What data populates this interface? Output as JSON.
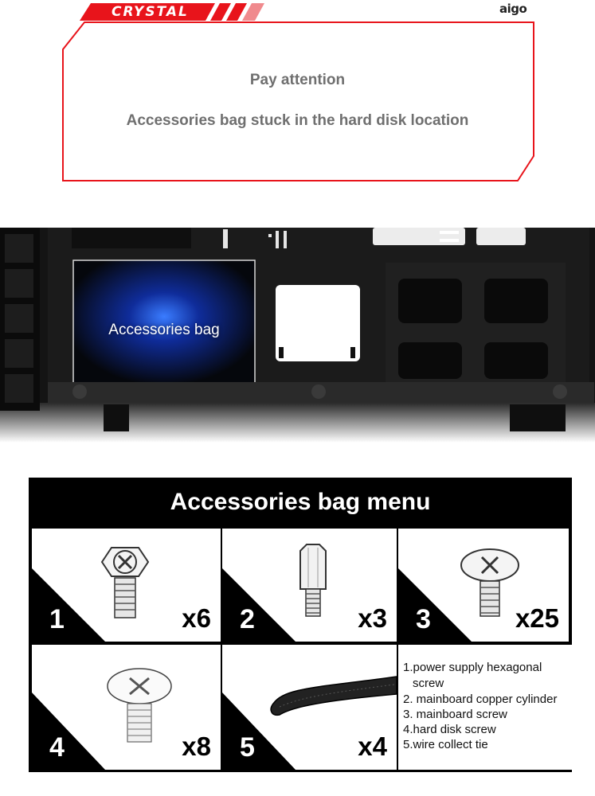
{
  "header": {
    "brand_tag": "CRYSTAL",
    "logo": "aigo",
    "accent_color": "#e8141b"
  },
  "notice": {
    "title": "Pay attention",
    "message": "Accessories bag stuck in the hard disk location"
  },
  "photo": {
    "bag_label": "Accessories bag"
  },
  "menu": {
    "title": "Accessories bag menu",
    "items": [
      {
        "number": "1",
        "quantity": "x6",
        "icon": "hex-screw-icon"
      },
      {
        "number": "2",
        "quantity": "x3",
        "icon": "copper-cylinder-icon"
      },
      {
        "number": "3",
        "quantity": "x25",
        "icon": "mainboard-screw-icon"
      },
      {
        "number": "4",
        "quantity": "x8",
        "icon": "hard-disk-screw-icon"
      },
      {
        "number": "5",
        "quantity": "x4",
        "icon": "cable-tie-icon"
      }
    ],
    "legend": [
      "1.power supply hexagonal",
      "screw",
      "2. mainboard copper cylinder",
      "3.  mainboard screw",
      "4.hard disk screw",
      "5.wire collect tie"
    ]
  }
}
